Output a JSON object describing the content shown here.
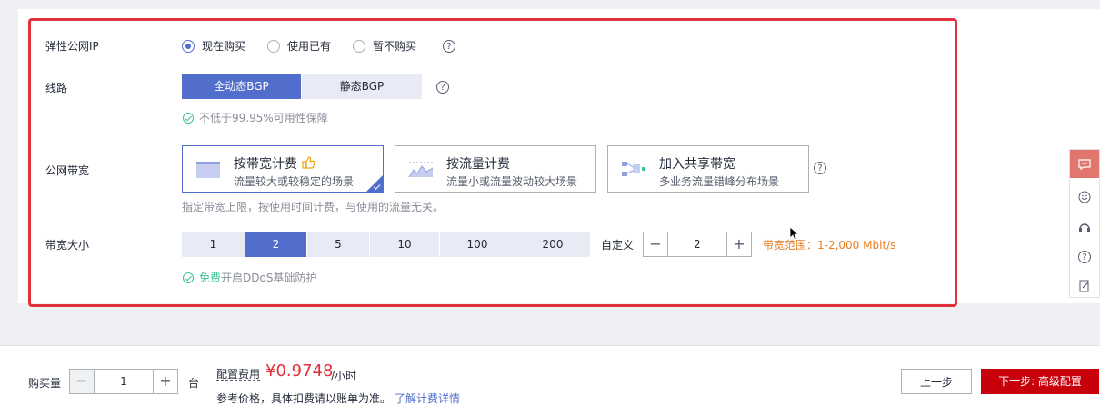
{
  "eip": {
    "label": "弹性公网IP",
    "options": [
      "现在购买",
      "使用已有",
      "暂不购买"
    ],
    "selected": "现在购买",
    "help_icon": "question-icon"
  },
  "line": {
    "label": "线路",
    "options": [
      "全动态BGP",
      "静态BGP"
    ],
    "selected": "全动态BGP",
    "note": "不低于99.95%可用性保障"
  },
  "bandwidth_billing": {
    "label": "公网带宽",
    "cards": [
      {
        "title": "按带宽计费",
        "subtitle": "流量较大或较稳定的场景",
        "icon": "bandwidth-chart-icon",
        "badge_icon": "thumbs-up-icon"
      },
      {
        "title": "按流量计费",
        "subtitle": "流量小或流量波动较大场景",
        "icon": "traffic-chart-icon"
      },
      {
        "title": "加入共享带宽",
        "subtitle": "多业务流量错峰分布场景",
        "icon": "shared-bandwidth-icon"
      }
    ],
    "selected": "按带宽计费",
    "note": "指定带宽上限，按使用时间计费，与使用的流量无关。"
  },
  "bandwidth_size": {
    "label": "带宽大小",
    "options": [
      "1",
      "2",
      "5",
      "10",
      "100",
      "200"
    ],
    "selected": "2",
    "custom_label": "自定义",
    "custom_value": "2",
    "range": "带宽范围：1-2,000 Mbit/s",
    "ddos_free": "免费",
    "ddos_text": "开启DDoS基础防护"
  },
  "footer": {
    "qty_label": "购买量",
    "qty_value": "1",
    "qty_unit": "台",
    "fee_label": "配置费用",
    "price": "¥0.9748",
    "price_unit": "/小时",
    "ref_note": "参考价格，具体扣费请以账单为准。",
    "ref_link": "了解计费详情",
    "prev_button": "上一步",
    "next_button": "下一步: 高级配置"
  },
  "colors": {
    "accent": "#526ecc",
    "price": "#e0313c",
    "primary_button": "#c7000b",
    "range_text": "#e67e22",
    "success": "#3ac295",
    "highlight_border": "#e0313c"
  }
}
